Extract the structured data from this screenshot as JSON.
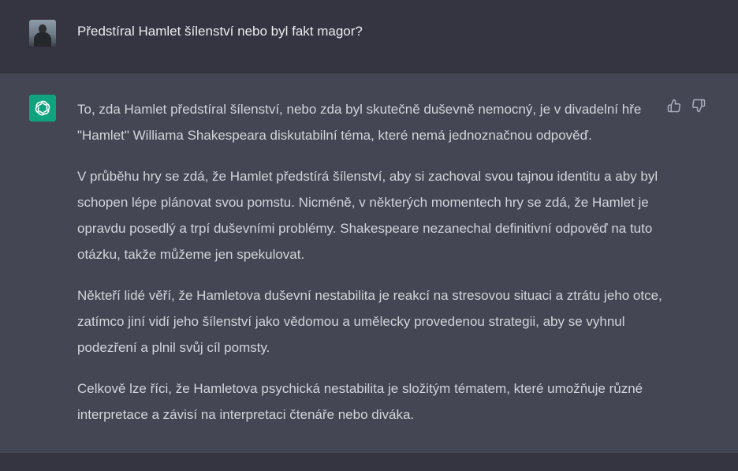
{
  "user_message": {
    "text": "Předstíral Hamlet šílenství nebo byl fakt magor?"
  },
  "assistant_message": {
    "paragraphs": [
      "To, zda Hamlet předstíral šílenství, nebo zda byl skutečně duševně nemocný, je v divadelní hře \"Hamlet\" Williama Shakespeara diskutabilní téma, které nemá jednoznačnou odpověď.",
      "V průběhu hry se zdá, že Hamlet předstírá šílenství, aby si zachoval svou tajnou identitu a aby byl schopen lépe plánovat svou pomstu. Nicméně, v některých momentech hry se zdá, že Hamlet je opravdu posedlý a trpí duševními problémy. Shakespeare nezanechal definitivní odpověď na tuto otázku, takže můžeme jen spekulovat.",
      "Někteří lidé věří, že Hamletova duševní nestabilita je reakcí na stresovou situaci a ztrátu jeho otce, zatímco jiní vidí jeho šílenství jako vědomou a umělecky provedenou strategii, aby se vyhnul podezření a plnil svůj cíl pomsty.",
      "Celkově lze říci, že Hamletova psychická nestabilita je složitým tématem, které umožňuje různé interpretace a závisí na interpretaci čtenáře nebo diváka."
    ]
  },
  "icons": {
    "user_avatar": "user-avatar",
    "bot_avatar": "openai-logo-icon",
    "like": "thumbs-up-icon",
    "dislike": "thumbs-down-icon"
  },
  "colors": {
    "page_background": "#343541",
    "assistant_background": "#444654",
    "bot_avatar": "#10a37f",
    "text_user": "#ececf1",
    "text_assistant": "#d1d5db",
    "icon": "#acacbe"
  }
}
